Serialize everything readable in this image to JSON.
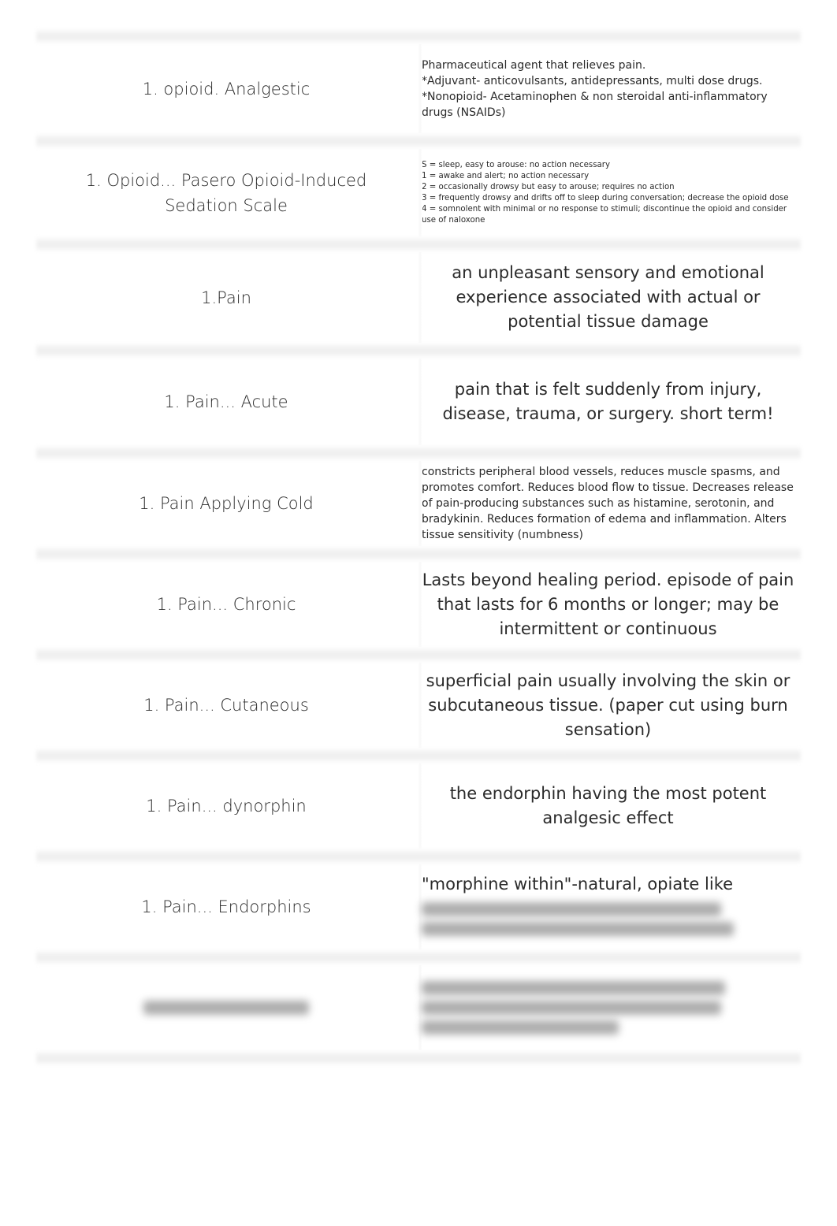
{
  "document": {
    "type": "flashcard-list",
    "rows": [
      {
        "term": "1. opioid. Analgestic",
        "definition_lines": [
          "Pharmaceutical agent that relieves pain.",
          "*Adjuvant- anticovulsants, antidepressants, multi dose drugs.",
          "*Nonopioid- Acetaminophen & non steroidal anti-inflammatory drugs (NSAIDs)"
        ]
      },
      {
        "term": "1. Opioid... Pasero Opioid-Induced Sedation Scale",
        "definition_lines": [
          "S = sleep, easy to arouse: no action necessary",
          "1 = awake and alert; no action necessary",
          "2 = occasionally drowsy but easy to arouse; requires no action",
          "3 = frequently drowsy and drifts off to sleep during conversation; decrease the opioid dose",
          "4 = somnolent with minimal or no response to stimuli; discontinue the opioid and consider use of naloxone"
        ]
      },
      {
        "term": "1.Pain",
        "definition": "an unpleasant sensory and emotional experience associated with actual or potential tissue damage"
      },
      {
        "term": "1. Pain... Acute",
        "definition": "pain that is felt suddenly from injury, disease, trauma, or surgery. short term!"
      },
      {
        "term": "1. Pain Applying Cold",
        "definition": "constricts peripheral blood vessels, reduces muscle spasms, and promotes comfort. Reduces blood flow to tissue. Decreases release of pain-producing substances such as histamine, serotonin, and bradykinin. Reduces formation of edema and inflammation. Alters tissue sensitivity (numbness)"
      },
      {
        "term": "1. Pain... Chronic",
        "definition": "Lasts beyond healing period. episode of pain that lasts for 6 months or longer; may be intermittent or continuous"
      },
      {
        "term": "1. Pain... Cutaneous",
        "definition": "superficial pain usually involving the skin or subcutaneous tissue. (paper cut using burn sensation)"
      },
      {
        "term": "1. Pain... dynorphin",
        "definition": "the endorphin having the most potent analgesic effect"
      },
      {
        "term": "1. Pain... Endorphins",
        "definition_visible": "\"morphine within\"-natural, opiate like",
        "definition_blurred": true
      },
      {
        "term_blurred": true,
        "definition_blurred": true
      }
    ]
  }
}
